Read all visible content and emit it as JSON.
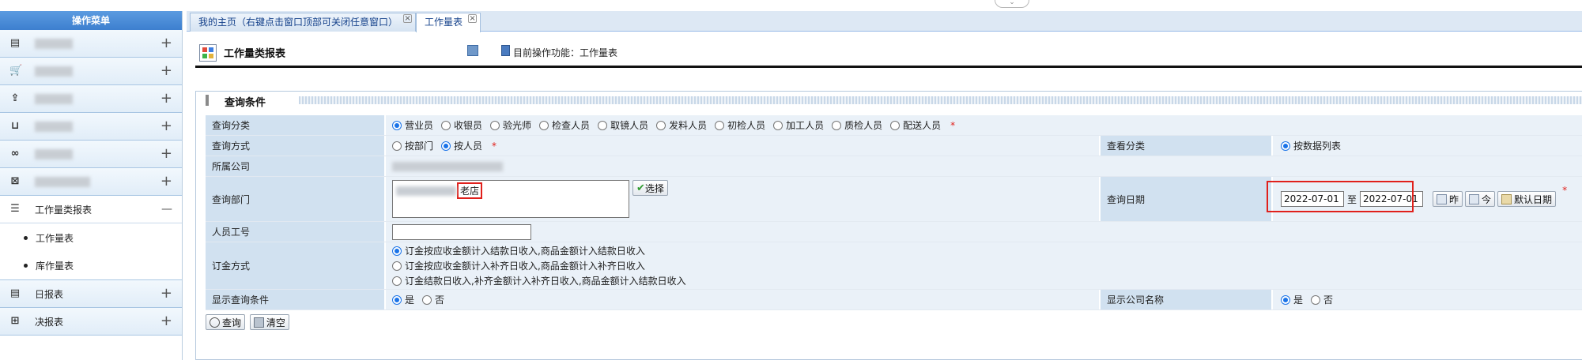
{
  "sidebar": {
    "header": "操作菜单",
    "items": [
      {
        "icon": "list-icon",
        "label": "",
        "toggle": "+"
      },
      {
        "icon": "cart-icon",
        "label": "",
        "toggle": "+"
      },
      {
        "icon": "export-icon",
        "label": "",
        "toggle": "+"
      },
      {
        "icon": "basket-icon",
        "label": "",
        "toggle": "+"
      },
      {
        "icon": "infinity-icon",
        "label": "",
        "toggle": "+"
      },
      {
        "icon": "box-icon",
        "label": "",
        "toggle": "+"
      },
      {
        "icon": "report-list-icon",
        "label": "工作量类报表",
        "toggle": "—"
      },
      {
        "icon": "doc-icon",
        "label": "日报表",
        "toggle": "+"
      },
      {
        "icon": "board-icon",
        "label": "决报表",
        "toggle": "+"
      }
    ],
    "sub_items": [
      "工作量表",
      "库作量表"
    ]
  },
  "tabs": [
    {
      "label": "我的主页（右键点击窗口顶部可关闭任意窗口）"
    },
    {
      "label": "工作量表"
    }
  ],
  "header": {
    "title": "工作量类报表",
    "function_label": "目前操作功能：工作量表"
  },
  "panel": {
    "title": "查询条件",
    "rows": {
      "query_category": {
        "label": "查询分类",
        "options": [
          "营业员",
          "收银员",
          "验光师",
          "检查人员",
          "取镜人员",
          "发料人员",
          "初检人员",
          "加工人员",
          "质检人员",
          "配送人员"
        ],
        "selected": 0
      },
      "query_method": {
        "label": "查询方式",
        "options": [
          "按部门",
          "按人员"
        ],
        "selected": 1
      },
      "view_category": {
        "label": "查看分类",
        "options": [
          "按数据列表"
        ],
        "selected": 0
      },
      "company": {
        "label": "所属公司"
      },
      "dept": {
        "label": "查询部门",
        "value_suffix": "老店",
        "select_button": "选择"
      },
      "date": {
        "label": "查询日期",
        "start": "2022-07-01",
        "sep": "至",
        "end": "2022-07-01",
        "btn_yesterday": "昨",
        "btn_today": "今",
        "btn_default": "默认日期"
      },
      "employee_id": {
        "label": "人员工号",
        "value": ""
      },
      "deposit": {
        "label": "订金方式",
        "options": [
          "订金按应收金额计入结款日收入,商品金额计入结款日收入",
          "订金按应收金额计入补齐日收入,商品金额计入补齐日收入",
          "订金结款日收入,补齐金额计入补齐日收入,商品金额计入结款日收入"
        ],
        "selected": 0
      },
      "show_query": {
        "label": "显示查询条件",
        "options": [
          "是",
          "否"
        ],
        "selected": 0
      },
      "show_company": {
        "label": "显示公司名称",
        "options": [
          "是",
          "否"
        ],
        "selected": 0
      }
    },
    "buttons": {
      "query": "查询",
      "clear": "清空"
    }
  },
  "required_mark": "*"
}
